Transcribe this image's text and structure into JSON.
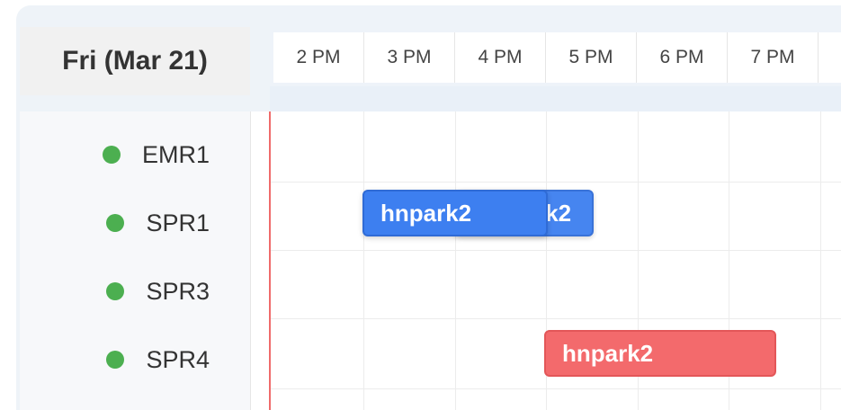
{
  "day_header": "Fri (Mar 21)",
  "time_slots": [
    "2 PM",
    "3 PM",
    "4 PM",
    "5 PM",
    "6 PM",
    "7 PM"
  ],
  "resources": [
    {
      "name": "EMR1",
      "status_color": "#4caf50"
    },
    {
      "name": "SPR1",
      "status_color": "#4caf50"
    },
    {
      "name": "SPR3",
      "status_color": "#4caf50"
    },
    {
      "name": "SPR4",
      "status_color": "#4caf50"
    }
  ],
  "events": [
    {
      "label": "hnpark2",
      "resource": "SPR1",
      "color": "#3d7ff0"
    },
    {
      "label": "hnpark2",
      "resource": "SPR1",
      "color": "#3d7ff0"
    },
    {
      "label": "hnpark2",
      "resource": "SPR4",
      "color": "#f36a6c"
    }
  ],
  "colors": {
    "status_online": "#4caf50",
    "now_indicator": "#f06b6b"
  }
}
